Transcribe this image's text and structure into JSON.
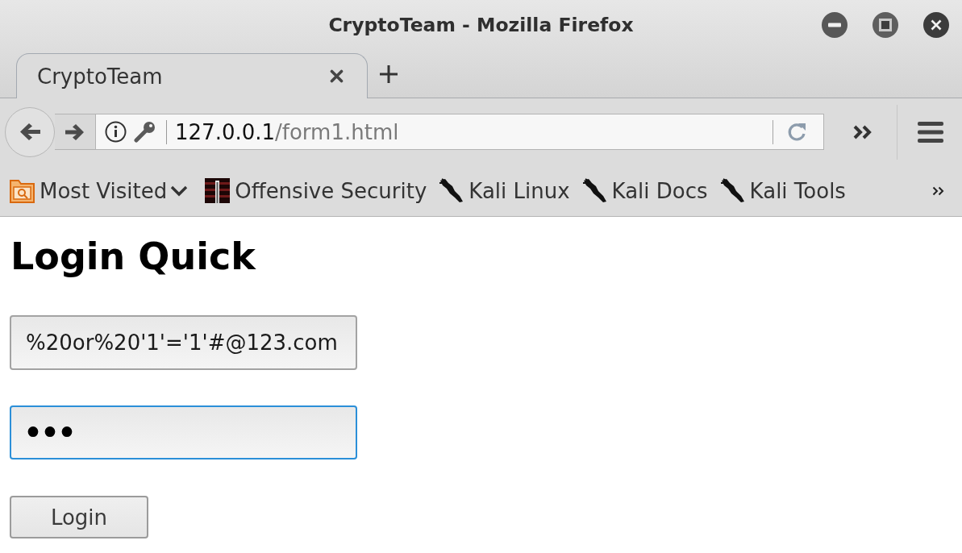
{
  "window": {
    "title": "CryptoTeam - Mozilla Firefox"
  },
  "tabs": [
    {
      "label": "CryptoTeam",
      "selected": true
    }
  ],
  "address_bar": {
    "host": "127.0.0.1",
    "path": "/form1.html"
  },
  "bookmarks": [
    {
      "label": "Most Visited",
      "kind": "folder"
    },
    {
      "label": "Offensive Security",
      "kind": "tile"
    },
    {
      "label": "Kali Linux",
      "kind": "mark"
    },
    {
      "label": "Kali Docs",
      "kind": "mark"
    },
    {
      "label": "Kali Tools",
      "kind": "mark"
    }
  ],
  "page": {
    "heading": "Login Quick",
    "fields": [
      {
        "kind": "text",
        "value": "%20or%20'1'='1'#@123.com",
        "focused": false
      },
      {
        "kind": "password",
        "value": "•••",
        "focused": true
      }
    ],
    "button": "Login"
  }
}
